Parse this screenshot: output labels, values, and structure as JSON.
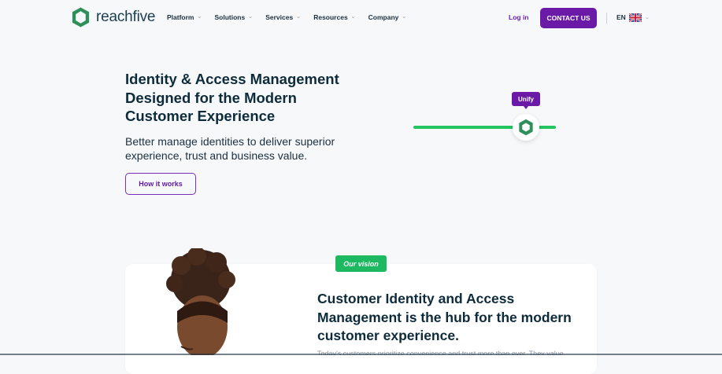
{
  "header": {
    "brand": "reachfive",
    "nav": [
      {
        "label": "Platform"
      },
      {
        "label": "Solutions"
      },
      {
        "label": "Services"
      },
      {
        "label": "Resources"
      },
      {
        "label": "Company"
      }
    ],
    "login_label": "Log in",
    "contact_label": "CONTACT US",
    "language": "EN",
    "flag_icon": "uk-flag-icon"
  },
  "hero": {
    "title": "Identity & Access Management Designed for the Modern Customer Experience",
    "subtitle": "Better manage identities to deliver superior experience, trust and business value.",
    "cta_label": "How it works",
    "slider_badge": "Unify"
  },
  "vision": {
    "badge": "Our vision",
    "title": "Customer Identity and Access Management is the hub for the modern customer experience.",
    "body": "Today's customers prioritize convenience and trust more than ever. They value"
  },
  "colors": {
    "accent_purple": "#6a1aa7",
    "accent_green": "#22c55e",
    "brand_green": "#2e8b57",
    "background": "#f6f8fa"
  }
}
